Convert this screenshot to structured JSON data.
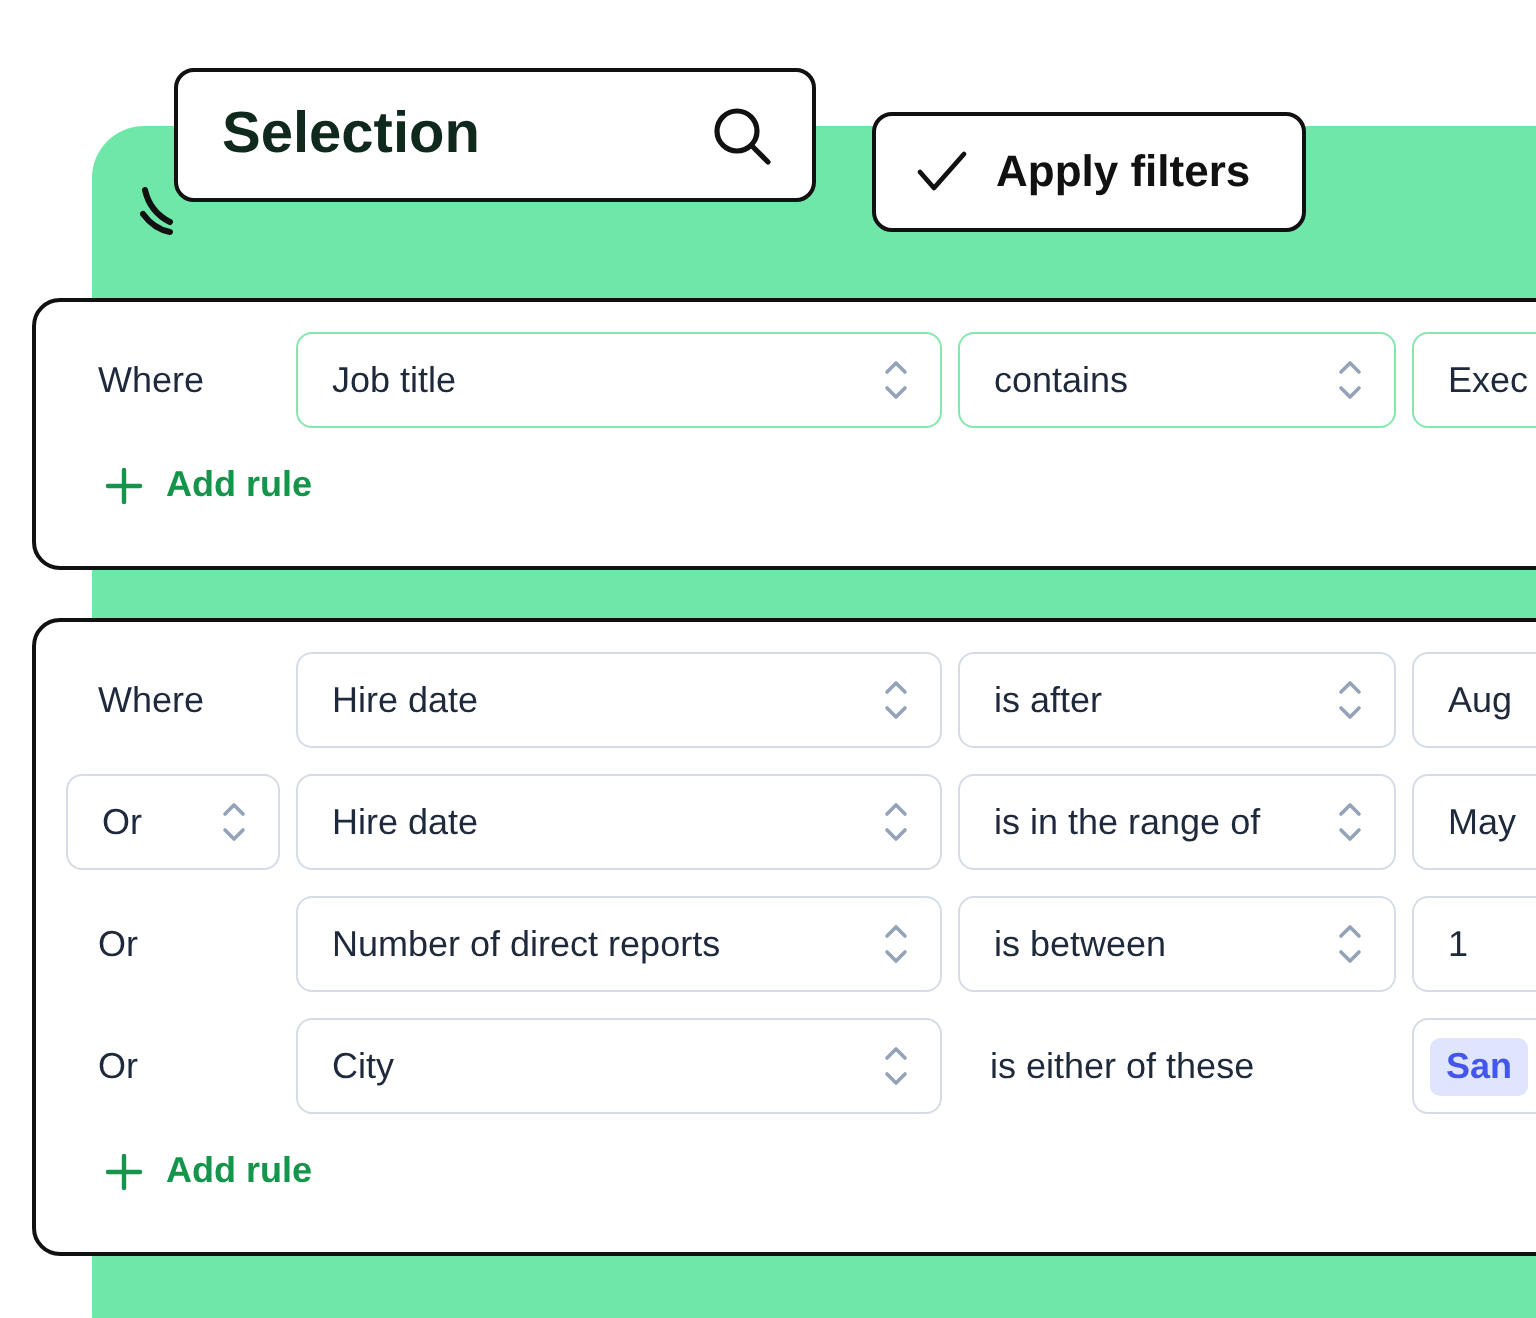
{
  "header": {
    "search_field": {
      "value": "Selection"
    },
    "apply_button": {
      "label": "Apply filters"
    }
  },
  "groups": [
    {
      "highlighted": true,
      "rules": [
        {
          "connector": {
            "kind": "text",
            "label": "Where"
          },
          "field": "Job title",
          "operator": {
            "kind": "select",
            "label": "contains"
          },
          "value": {
            "kind": "input",
            "text": "Exec"
          }
        }
      ],
      "add_rule": "Add rule"
    },
    {
      "highlighted": false,
      "rules": [
        {
          "connector": {
            "kind": "text",
            "label": "Where"
          },
          "field": "Hire date",
          "operator": {
            "kind": "select",
            "label": "is after"
          },
          "value": {
            "kind": "input",
            "text": "Aug"
          }
        },
        {
          "connector": {
            "kind": "select",
            "label": "Or"
          },
          "field": "Hire date",
          "operator": {
            "kind": "select",
            "label": "is in the range of"
          },
          "value": {
            "kind": "input",
            "text": "May"
          }
        },
        {
          "connector": {
            "kind": "text",
            "label": "Or"
          },
          "field": "Number of direct reports",
          "operator": {
            "kind": "select",
            "label": "is between"
          },
          "value": {
            "kind": "input",
            "text": "1"
          }
        },
        {
          "connector": {
            "kind": "text",
            "label": "Or"
          },
          "field": "City",
          "operator": {
            "kind": "text",
            "label": "is either of these"
          },
          "value": {
            "kind": "tags",
            "tags": [
              "San"
            ]
          }
        }
      ],
      "add_rule": "Add rule"
    }
  ]
}
